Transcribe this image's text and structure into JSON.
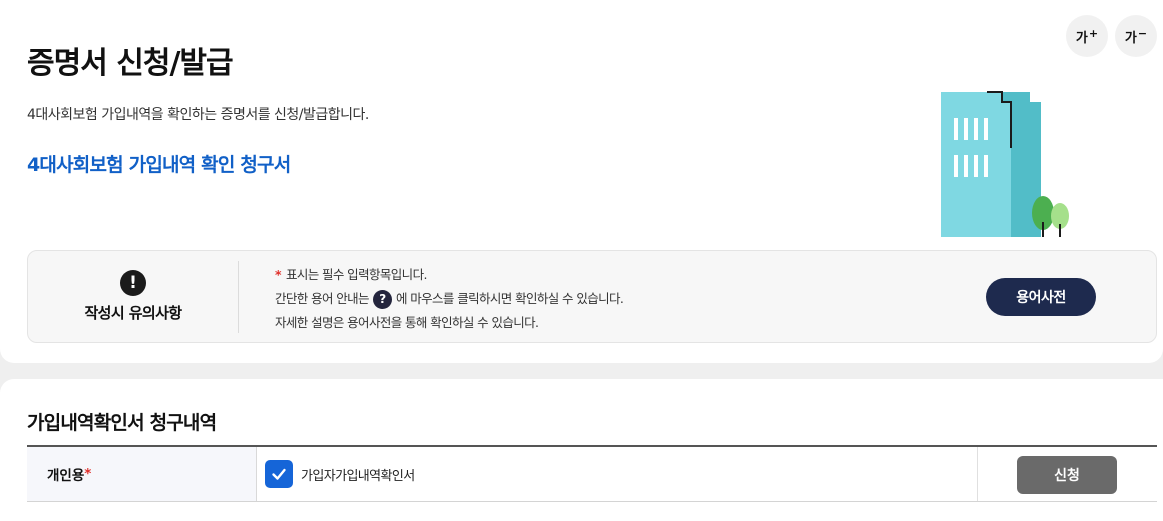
{
  "header": {
    "title": "증명서 신청/발급",
    "description": "4대사회보험 가입내역을 확인하는 증명서를 신청/발급합니다.",
    "subtitle": "4대사회보험 가입내역 확인 청구서",
    "font_increase": {
      "label": "가",
      "mark": "+"
    },
    "font_decrease": {
      "label": "가",
      "mark": "−"
    }
  },
  "notice": {
    "icon": "!",
    "heading": "작성시 유의사항",
    "line1": {
      "star": "*",
      "text": "표시는 필수 입력항목입니다."
    },
    "line2": {
      "before": "간단한 용어 안내는",
      "icon": "?",
      "after": "에 마우스를 클릭하시면 확인하실 수 있습니다."
    },
    "line3": "자세한 설명은 용어사전을 통해 확인하실 수 있습니다.",
    "glossary_button": "용어사전"
  },
  "request": {
    "section_title": "가입내역확인서 청구내역",
    "row_label": "개인용",
    "row_required": "*",
    "checkbox_checked": true,
    "checkbox_label": "가입자가입내역확인서",
    "apply_button": "신청"
  },
  "colors": {
    "accent_blue": "#1160c7",
    "navy_button": "#1e2a4e",
    "checkbox_blue": "#1565d8",
    "required_red": "#e0302b",
    "apply_gray": "#6a6a6a"
  }
}
